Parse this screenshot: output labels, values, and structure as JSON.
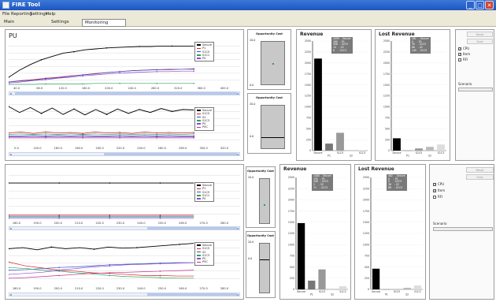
{
  "window": {
    "title": "FIRE Tool",
    "min": "_",
    "max": "□",
    "close": "✕"
  },
  "menu": [
    "File",
    "Reporting",
    "Settings",
    "Help"
  ],
  "tabs": [
    "Main",
    "Settings",
    "Monitoring"
  ],
  "top_panel": {
    "title": "PU"
  },
  "series_names": [
    "Secure",
    "P1",
    "S1C5",
    "S1C1",
    "P0",
    "S2",
    "S1C3",
    "P0C"
  ],
  "top_chart1": {
    "x_ticks": [
      "40.0",
      "80.0",
      "120.0",
      "160.0",
      "200.0",
      "240.0",
      "280.0",
      "320.0",
      "360.0",
      "400.0"
    ],
    "legend": [
      "Secure",
      "P1",
      "S1C5",
      "S1C1",
      "P0"
    ],
    "colors": [
      "#000000",
      "#d62020",
      "#3050c8",
      "#30a060",
      "#8a4ad0"
    ],
    "series": [
      [
        0.2,
        0.35,
        0.47,
        0.57,
        0.64,
        0.71,
        0.74,
        0.78,
        0.8,
        0.82,
        0.83,
        0.84,
        0.85,
        0.85,
        0.86,
        0.86,
        0.86,
        0.86
      ],
      [
        0.1,
        0.13,
        0.15,
        0.18,
        0.2,
        0.23,
        0.25,
        0.28,
        0.3,
        0.32,
        0.34,
        0.35,
        0.36,
        0.36,
        0.37,
        0.37
      ],
      [
        0.1,
        0.12,
        0.14,
        0.17,
        0.19,
        0.22,
        0.25,
        0.27,
        0.3,
        0.32,
        0.34,
        0.35,
        0.36,
        0.37,
        0.37,
        0.38
      ],
      [
        0.05,
        0.05,
        0.05,
        0.06,
        0.06,
        0.06,
        0.06,
        0.07,
        0.07,
        0.07,
        0.07,
        0.07,
        0.07,
        0.07,
        0.07,
        0.07
      ],
      [
        0.08,
        0.1,
        0.13,
        0.15,
        0.18,
        0.2,
        0.23,
        0.25,
        0.27,
        0.29,
        0.3,
        0.31,
        0.32,
        0.32,
        0.33,
        0.33
      ]
    ]
  },
  "top_chart2": {
    "x_ticks": [
      "0.0",
      "140.0",
      "160.0",
      "180.0",
      "200.0",
      "220.0",
      "240.0",
      "260.0",
      "280.0",
      "300.0",
      "320.0"
    ],
    "legend": [
      "Secure",
      "S1C5",
      "S2",
      "S1C3",
      "P0",
      "P0C"
    ],
    "colors": [
      "#000000",
      "#d62020",
      "#3050c8",
      "#30a060",
      "#8a4ad0",
      "#c03090"
    ],
    "series": [
      [
        0.82,
        0.7,
        0.8,
        0.68,
        0.79,
        0.66,
        0.77,
        0.65,
        0.76,
        0.66,
        0.77,
        0.68,
        0.76,
        0.7,
        0.78,
        0.72,
        0.76,
        0.75
      ],
      [
        0.28,
        0.3,
        0.27,
        0.3,
        0.28,
        0.29,
        0.27,
        0.3,
        0.28,
        0.29,
        0.27,
        0.3,
        0.28,
        0.29,
        0.28,
        0.29
      ],
      [
        0.22,
        0.22,
        0.23,
        0.22,
        0.23,
        0.22,
        0.23,
        0.22,
        0.22,
        0.23,
        0.22,
        0.23,
        0.22,
        0.23,
        0.22,
        0.22
      ],
      [
        0.25,
        0.26,
        0.25,
        0.26,
        0.25,
        0.26,
        0.25,
        0.26,
        0.25,
        0.26,
        0.25,
        0.26,
        0.25,
        0.26,
        0.25,
        0.26
      ],
      [
        0.2,
        0.2,
        0.2,
        0.2,
        0.2,
        0.2,
        0.2,
        0.2,
        0.2,
        0.2,
        0.2,
        0.2,
        0.2,
        0.2,
        0.2,
        0.2
      ],
      [
        0.18,
        0.18,
        0.18,
        0.18,
        0.18,
        0.18,
        0.18,
        0.18,
        0.18,
        0.18,
        0.18,
        0.18,
        0.18,
        0.18,
        0.18,
        0.18
      ]
    ]
  },
  "bottom_chart1": {
    "x_ticks": [
      "180.0",
      "190.0",
      "200.0",
      "210.0",
      "220.0",
      "230.0",
      "240.0",
      "250.0",
      "260.0",
      "270.0",
      "280.0"
    ],
    "legend": [
      "Secure",
      "P1",
      "S1C5",
      "S1C1",
      "P0"
    ],
    "colors": [
      "#000000",
      "#d62020",
      "#3050c8",
      "#30a060",
      "#8a4ad0"
    ],
    "series": [
      [
        0.72,
        0.72,
        0.72,
        0.72,
        0.72,
        0.72,
        0.72,
        0.72,
        0.72,
        0.72,
        0.72,
        0.72
      ],
      [
        0.12,
        0.12,
        0.12,
        0.12,
        0.12,
        0.12,
        0.12,
        0.12,
        0.12,
        0.12,
        0.12,
        0.12
      ],
      [
        0.1,
        0.1,
        0.1,
        0.1,
        0.1,
        0.1,
        0.1,
        0.1,
        0.1,
        0.1,
        0.1,
        0.1
      ],
      [
        0.08,
        0.08,
        0.08,
        0.08,
        0.08,
        0.08,
        0.08,
        0.08,
        0.08,
        0.08,
        0.08,
        0.08
      ],
      [
        0.06,
        0.06,
        0.06,
        0.06,
        0.06,
        0.06,
        0.06,
        0.06,
        0.06,
        0.06,
        0.06,
        0.06
      ]
    ]
  },
  "bottom_chart2": {
    "x_ticks": [
      "180.0",
      "190.0",
      "200.0",
      "210.0",
      "220.0",
      "230.0",
      "240.0",
      "250.0",
      "260.0",
      "270.0",
      "280.0"
    ],
    "legend": [
      "Secure",
      "S1C5",
      "S2",
      "S1C3",
      "P0",
      "P0C"
    ],
    "colors": [
      "#000000",
      "#d62020",
      "#3050c8",
      "#30a060",
      "#8a4ad0",
      "#c03090"
    ],
    "series": [
      [
        0.7,
        0.72,
        0.68,
        0.73,
        0.7,
        0.72,
        0.69,
        0.73,
        0.71,
        0.72,
        0.74,
        0.76,
        0.78,
        0.8
      ],
      [
        0.45,
        0.38,
        0.34,
        0.3,
        0.28,
        0.25,
        0.24,
        0.22,
        0.2,
        0.2,
        0.19,
        0.19
      ],
      [
        0.3,
        0.31,
        0.33,
        0.35,
        0.36,
        0.38,
        0.4,
        0.41,
        0.42,
        0.43,
        0.44,
        0.44
      ],
      [
        0.35,
        0.33,
        0.3,
        0.28,
        0.25,
        0.23,
        0.2,
        0.18,
        0.17,
        0.16,
        0.15,
        0.15
      ],
      [
        0.22,
        0.24,
        0.26,
        0.3,
        0.33,
        0.36,
        0.38,
        0.4,
        0.41,
        0.42,
        0.43,
        0.44
      ],
      [
        0.15,
        0.16,
        0.18,
        0.2,
        0.22,
        0.24,
        0.25,
        0.26,
        0.27,
        0.28,
        0.29,
        0.3
      ]
    ]
  },
  "opp_top": [
    {
      "title": "Opportunity Cost",
      "top": "20.0",
      "bottom": "0.0"
    },
    {
      "title": "Opportunity Cost",
      "top": "20.0",
      "bottom": "0.0"
    }
  ],
  "opp_bottom": [
    {
      "title": "Opportunity Cost",
      "top": "20.0",
      "bottom": "0.0"
    },
    {
      "title": "Opportunity Cost",
      "top": "20.0",
      "bottom": "0.0"
    }
  ],
  "revenue_top": {
    "title": "Revenue",
    "legend": "2099  - Secure\n160   - P1\n406   - S2C5\n10    - S2\n6     - S1C3",
    "y_ticks": [
      "2500",
      "2250",
      "2000",
      "1750",
      "1500",
      "1250",
      "1000",
      "750",
      "500",
      "250",
      "0"
    ],
    "categories": [
      "Secure",
      "S1C5",
      "S1C3"
    ],
    "x_sub": [
      "P1",
      "S2"
    ],
    "values": [
      2099,
      160,
      406,
      10,
      6
    ],
    "colors": [
      "#000000",
      "#777777",
      "#999999",
      "#bbbbbb",
      "#dddddd"
    ],
    "ymax": 2500
  },
  "lost_top": {
    "title": "Lost Revenue",
    "legend": "281   - Secure\n0     - P1\n50    - S2C5\n86    - S2\n140   - S1C3",
    "y_ticks": [
      "2500",
      "2250",
      "2000",
      "1750",
      "1500",
      "1250",
      "1000",
      "750",
      "500",
      "250",
      "0"
    ],
    "categories": [
      "Secure",
      "S1C5",
      "S1C3"
    ],
    "x_sub": [
      "P1",
      "S2"
    ],
    "values": [
      281,
      0,
      50,
      86,
      140
    ],
    "colors": [
      "#000000",
      "#777777",
      "#999999",
      "#bbbbbb",
      "#dddddd"
    ],
    "ymax": 2500
  },
  "revenue_bottom": {
    "title": "Revenue",
    "legend": "1480  - Secure\n195   - P1\n446   - S2C5\n2     - S2\n71    - S1C3",
    "y_ticks": [
      "2500",
      "2250",
      "2000",
      "1750",
      "1500",
      "1250",
      "1000",
      "750",
      "500",
      "250",
      "0"
    ],
    "categories": [
      "Secure",
      "S1C5",
      "S1C3"
    ],
    "x_sub": [
      "P1",
      "S2"
    ],
    "values": [
      1480,
      195,
      446,
      2,
      71
    ],
    "colors": [
      "#000000",
      "#777777",
      "#999999",
      "#bbbbbb",
      "#dddddd"
    ],
    "ymax": 2500
  },
  "lost_bottom": {
    "title": "Lost Revenue",
    "legend": "462   - Secure\n0     - P1\n0     - S2C5\n36    - S2\n88    - S1C3",
    "y_ticks": [
      "2500",
      "2250",
      "2000",
      "1750",
      "1500",
      "1250",
      "1000",
      "750",
      "500",
      "250",
      "0"
    ],
    "categories": [
      "Secure",
      "S1C5",
      "S1C3"
    ],
    "x_sub": [
      "P1",
      "S2"
    ],
    "values": [
      462,
      0,
      0,
      36,
      88
    ],
    "colors": [
      "#000000",
      "#777777",
      "#999999",
      "#bbbbbb",
      "#dddddd"
    ],
    "ymax": 2500
  },
  "side_top": {
    "btn1": "Reset",
    "btn2": "Start",
    "checks": [
      {
        "label": "CPU",
        "checked": true
      },
      {
        "label": "Item",
        "checked": true
      },
      {
        "label": "RFI",
        "checked": false
      }
    ],
    "scenario_label": "Scenario"
  },
  "side_bottom": {
    "btn1": "Reset",
    "btn2": "Start",
    "checks": [
      {
        "label": "CPU",
        "checked": true
      },
      {
        "label": "Item",
        "checked": true
      },
      {
        "label": "RFI",
        "checked": false
      }
    ],
    "scenario_label": "Scenario"
  }
}
